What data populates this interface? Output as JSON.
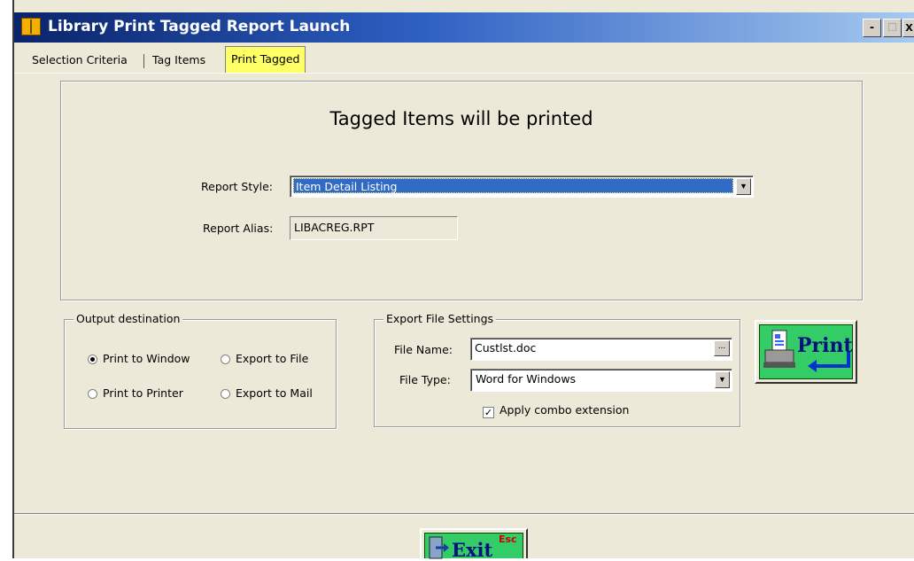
{
  "window": {
    "title": "Library Print Tagged Report Launch",
    "controls": {
      "minimize": "-",
      "maximize": "□",
      "close": "x"
    }
  },
  "tabs": [
    {
      "label": "Selection Criteria",
      "active": false
    },
    {
      "label": "Tag Items",
      "active": false
    },
    {
      "label": "Print Tagged",
      "active": true
    }
  ],
  "main": {
    "heading": "Tagged Items will be printed",
    "report_style": {
      "label": "Report Style:",
      "value": "Item Detail Listing"
    },
    "report_alias": {
      "label": "Report Alias:",
      "value": "LIBACREG.RPT"
    }
  },
  "output": {
    "title": "Output destination",
    "options": [
      {
        "label": "Print to Window",
        "selected": true
      },
      {
        "label": "Export to File",
        "selected": false
      },
      {
        "label": "Print to Printer",
        "selected": false
      },
      {
        "label": "Export to Mail",
        "selected": false
      }
    ]
  },
  "export": {
    "title": "Export  File Settings",
    "file_name": {
      "label": "File Name:",
      "value": "Custlst.doc",
      "browse": "..."
    },
    "file_type": {
      "label": "File Type:",
      "value": "Word for Windows"
    },
    "apply_combo": {
      "label": "Apply combo extension",
      "checked": true,
      "mark": "✓"
    }
  },
  "buttons": {
    "print": "Print",
    "exit": "Exit",
    "exit_shortcut": "Esc"
  },
  "colors": {
    "active_tab": "#FFFF66",
    "button_face": "#33CC66",
    "selection": "#316AC5"
  }
}
